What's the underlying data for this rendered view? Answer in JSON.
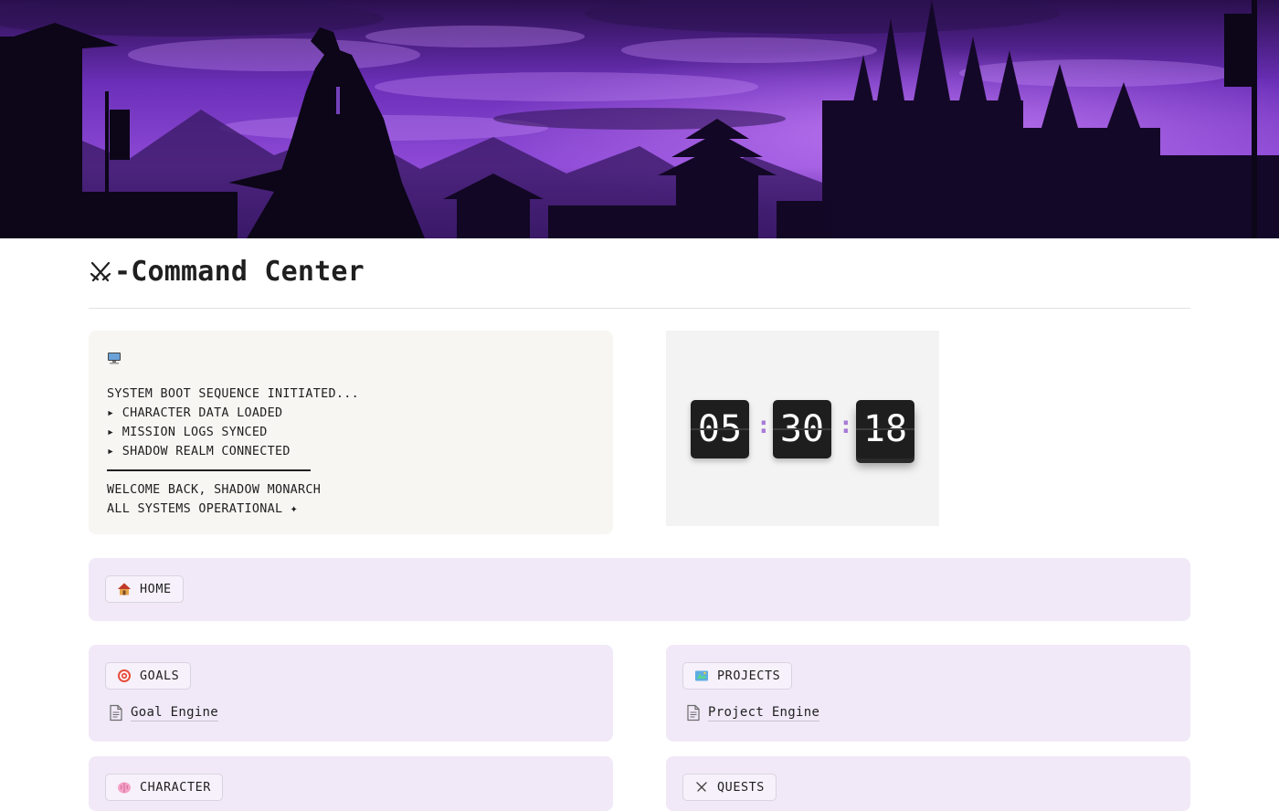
{
  "page": {
    "title": "-Command Center",
    "title_icon": "crossed-swords-icon"
  },
  "cover": {
    "description_icon": "dark-fantasy-castle-banner",
    "colors": {
      "sky": "#6b2fb8",
      "glow": "#b45cff",
      "silhouette": "#0c0618"
    }
  },
  "console": {
    "icon": "desktop-computer-icon",
    "lines": [
      "SYSTEM BOOT SEQUENCE INITIATED...",
      "▸ CHARACTER DATA LOADED",
      "▸ MISSION LOGS SYNCED",
      "▸ SHADOW REALM CONNECTED"
    ],
    "footer": [
      "WELCOME BACK, SHADOW MONARCH",
      "ALL SYSTEMS OPERATIONAL ✦"
    ]
  },
  "clock": {
    "hours": "05",
    "minutes": "30",
    "seconds": "18",
    "separator": ":",
    "colon_color": "#a77ad8"
  },
  "sections": {
    "home": {
      "icon": "house-icon",
      "label": "HOME"
    },
    "goals": {
      "icon": "target-icon",
      "label": "GOALS",
      "link": "Goal Engine"
    },
    "projects": {
      "icon": "map-icon",
      "label": "PROJECTS",
      "link": "Project Engine"
    },
    "character": {
      "icon": "brain-icon",
      "label": "CHARACTER"
    },
    "quests": {
      "icon": "swords-icon",
      "label": "QUESTS"
    }
  },
  "colors": {
    "card_bg": "#f1e9f8",
    "console_bg": "#f7f6f3",
    "clock_bg": "#f3f3f3"
  }
}
